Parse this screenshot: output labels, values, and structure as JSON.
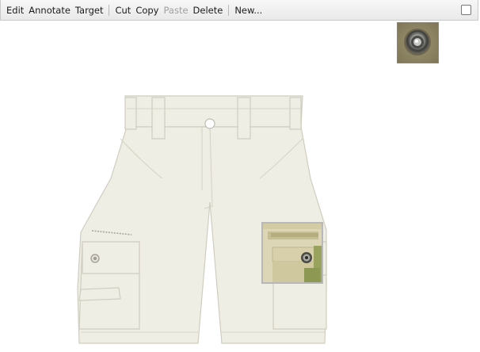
{
  "toolbar": {
    "edit": "Edit",
    "annotate": "Annotate",
    "target": "Target",
    "cut": "Cut",
    "copy": "Copy",
    "paste": "Paste",
    "delete": "Delete",
    "new": "New..."
  },
  "icons": {
    "checkbox": "checkbox-icon"
  },
  "colors": {
    "shorts_fabric": "#efeee5",
    "shorts_stitch": "#cfcdbf",
    "loupe_border": "#b8b8b8",
    "loupe_tan": "#d6cfa8",
    "loupe_green": "#9aa35e"
  }
}
